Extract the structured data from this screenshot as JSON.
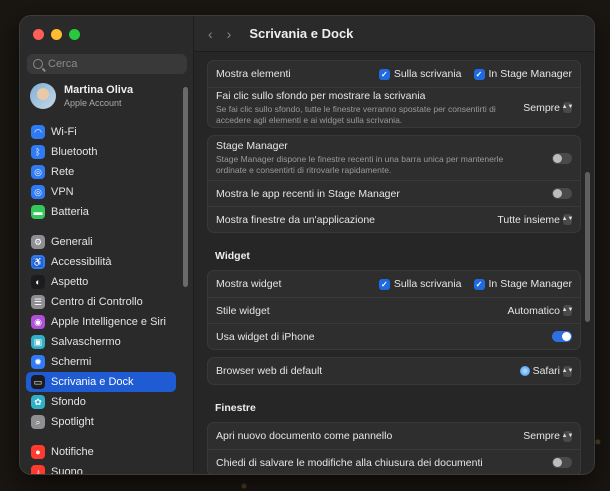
{
  "search": {
    "placeholder": "Cerca"
  },
  "account": {
    "name": "Martina Oliva",
    "subtitle": "Apple Account"
  },
  "sidebar": {
    "items": [
      {
        "label": "Wi-Fi",
        "icon": "wifi-icon",
        "color": "#2f7bf5"
      },
      {
        "label": "Bluetooth",
        "icon": "bluetooth-icon",
        "color": "#2f7bf5"
      },
      {
        "label": "Rete",
        "icon": "globe-icon",
        "color": "#2f7bf5"
      },
      {
        "label": "VPN",
        "icon": "vpn-globe-icon",
        "color": "#2f7bf5"
      },
      {
        "label": "Batteria",
        "icon": "battery-icon",
        "color": "#34c759"
      },
      {
        "label": "Generali",
        "icon": "gear-icon",
        "color": "#8e8e93"
      },
      {
        "label": "Accessibilità",
        "icon": "accessibility-icon",
        "color": "#2f7bf5"
      },
      {
        "label": "Aspetto",
        "icon": "appearance-icon",
        "color": "#1c1c1e"
      },
      {
        "label": "Centro di Controllo",
        "icon": "control-center-icon",
        "color": "#8e8e93"
      },
      {
        "label": "Apple Intelligence e Siri",
        "icon": "siri-icon",
        "color": "#b04fd8"
      },
      {
        "label": "Salvaschermo",
        "icon": "screensaver-icon",
        "color": "#30b0c7"
      },
      {
        "label": "Schermi",
        "icon": "display-icon",
        "color": "#2f7bf5"
      },
      {
        "label": "Scrivania e Dock",
        "icon": "dock-icon",
        "color": "#1c1c1e"
      },
      {
        "label": "Sfondo",
        "icon": "wallpaper-icon",
        "color": "#30b0c7"
      },
      {
        "label": "Spotlight",
        "icon": "spotlight-icon",
        "color": "#8e8e93"
      },
      {
        "label": "Notifiche",
        "icon": "bell-icon",
        "color": "#ff3b30"
      },
      {
        "label": "Suono",
        "icon": "speaker-icon",
        "color": "#ff3b30"
      }
    ]
  },
  "header": {
    "title": "Scrivania e Dock",
    "back": "‹",
    "forward": "›"
  },
  "desktop": {
    "show_items_label": "Mostra elementi",
    "on_desktop": "Sulla scrivania",
    "in_stage_manager": "In Stage Manager",
    "click_wallpaper_label": "Fai clic sullo sfondo per mostrare la scrivania",
    "click_wallpaper_desc": "Se fai clic sullo sfondo, tutte le finestre verranno spostate per consentirti di accedere agli elementi e ai widget sulla scrivania.",
    "click_wallpaper_value": "Sempre"
  },
  "stage": {
    "label": "Stage Manager",
    "desc": "Stage Manager dispone le finestre recenti in una barra unica per mantenerle ordinate e consentirti di ritrovarle rapidamente.",
    "recent_apps_label": "Mostra le app recenti in Stage Manager",
    "windows_label": "Mostra finestre da un'applicazione",
    "windows_value": "Tutte insieme"
  },
  "widget": {
    "section": "Widget",
    "show_label": "Mostra widget",
    "on_desktop": "Sulla scrivania",
    "in_stage_manager": "In Stage Manager",
    "style_label": "Stile widget",
    "style_value": "Automatico",
    "iphone_label": "Usa widget di iPhone"
  },
  "browser": {
    "label": "Browser web di default",
    "value": "Safari"
  },
  "windows": {
    "section": "Finestre",
    "open_doc_label": "Apri nuovo documento come pannello",
    "open_doc_value": "Sempre",
    "ask_save_label": "Chiedi di salvare le modifiche alla chiusura dei documenti"
  }
}
